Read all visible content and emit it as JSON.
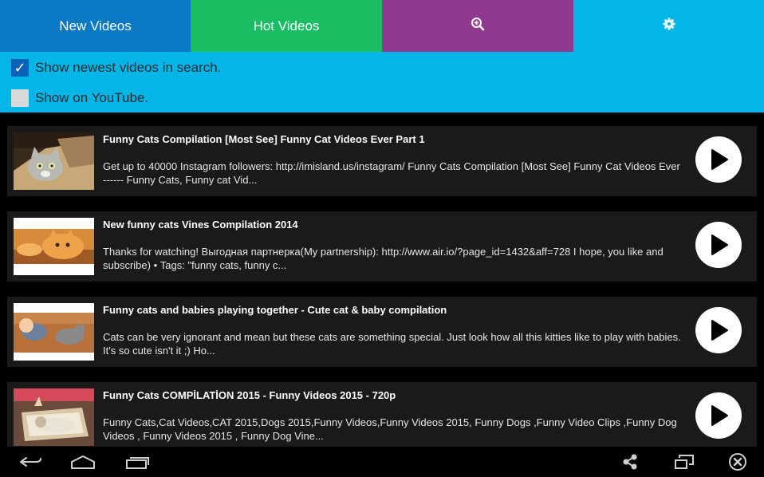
{
  "tabs": {
    "new_label": "New Videos",
    "hot_label": "Hot Videos",
    "search_icon": "zoom-in-icon",
    "settings_icon": "gear-icon"
  },
  "colors": {
    "tab_new": "#0b78c4",
    "tab_hot": "#1bbd63",
    "tab_search": "#8f3a8f",
    "tab_settings": "#04b6e8",
    "options_bg": "#04b6e8",
    "item_bg": "#1a1a1a"
  },
  "options": [
    {
      "label": "Show newest videos in search.",
      "checked": true
    },
    {
      "label": "Show on YouTube.",
      "checked": false
    }
  ],
  "videos": [
    {
      "title": "Funny Cats Compilation [Most See] Funny Cat Videos Ever Part 1",
      "description": "Get up to 40000 Instagram followers: http://imisland.us/instagram/ Funny Cats Compilation [Most See] Funny Cat Videos Ever ------ Funny Cats, Funny cat Vid..."
    },
    {
      "title": "New funny cats Vines Compilation 2014",
      "description": "Thanks for watching! Выгодная партнерка(My partnership): http://www.air.io/?page_id=1432&aff=728 I hope, you like and subscribe) • Tags: \"funny cats, funny c..."
    },
    {
      "title": "Funny cats and babies playing together - Cute cat & baby compilation",
      "description": "Cats can be very ignorant and mean but these cats are something special. Just look how all this kitties like to play with babies. It's so cute isn't it ;) Ho..."
    },
    {
      "title": "Funny Cats COMPİLATİON 2015 - Funny Videos 2015 - 720p",
      "description": "Funny Cats,Cat Videos,CAT 2015,Dogs 2015,Funny Videos,Funny Videos 2015, Funny Dogs ,Funny Video Clips ,Funny Dog Videos , Funny Videos 2015 , Funny Dog Vine..."
    }
  ],
  "navbar": {
    "back_icon": "back-icon",
    "home_icon": "home-icon",
    "recents_icon": "recent-apps-icon",
    "share_icon": "share-icon",
    "window_icon": "multi-window-icon",
    "close_icon": "close-icon"
  }
}
